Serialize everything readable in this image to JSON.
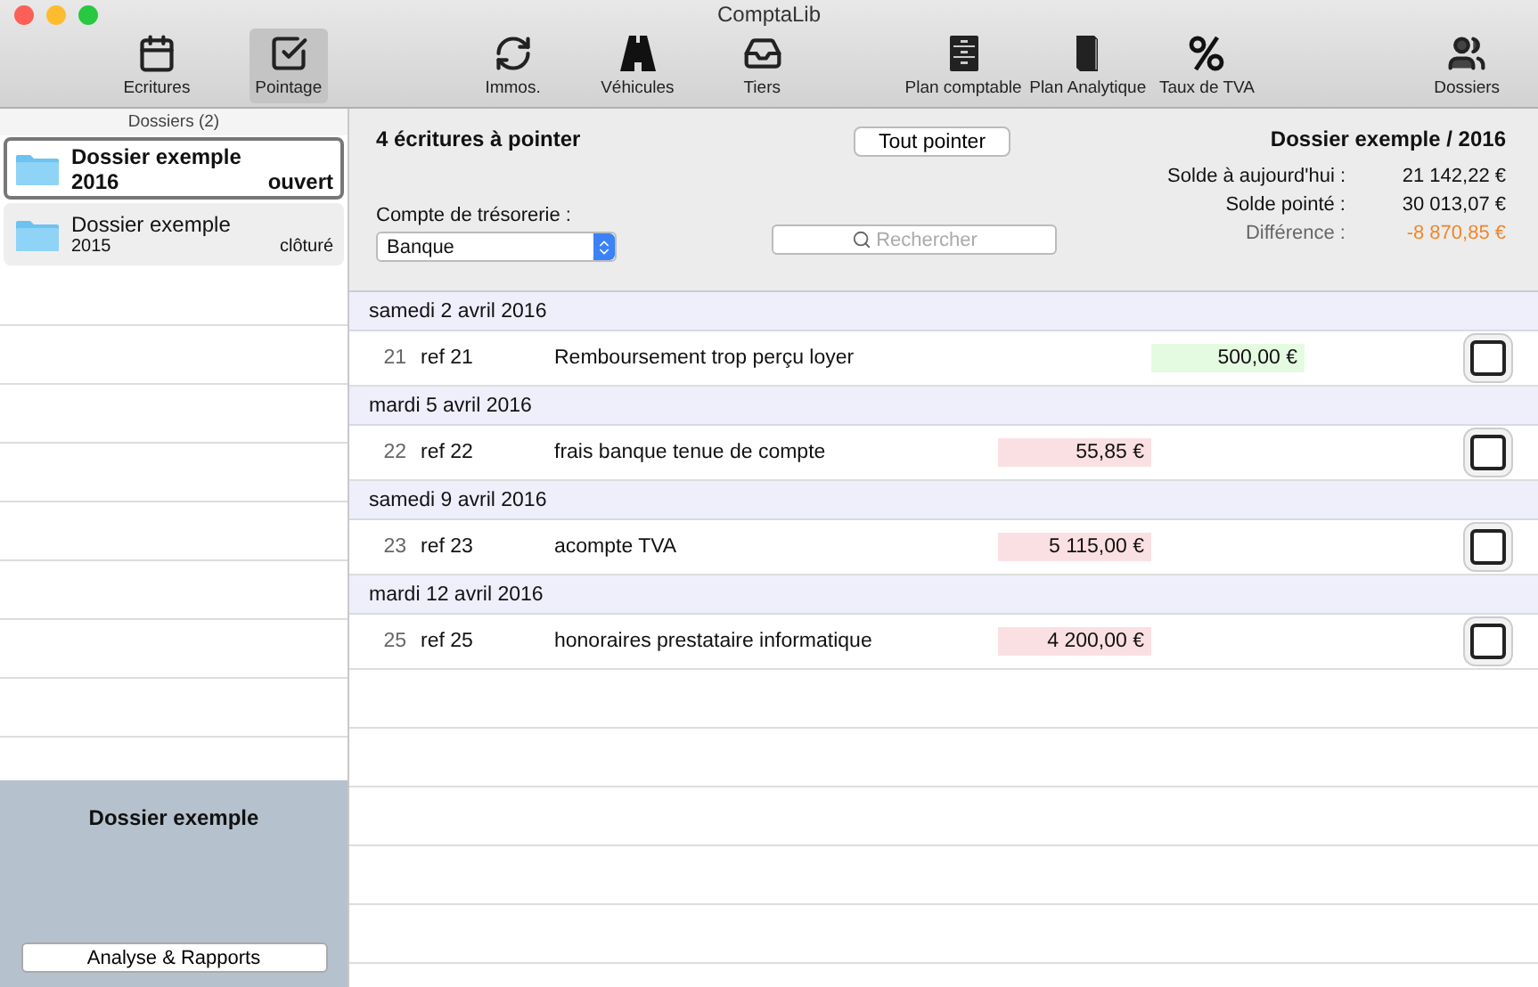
{
  "window": {
    "title": "ComptaLib"
  },
  "toolbar": [
    {
      "label": "Ecritures",
      "selected": false
    },
    {
      "label": "Pointage",
      "selected": true
    },
    {
      "label": "Immos.",
      "selected": false
    },
    {
      "label": "Véhicules",
      "selected": false
    },
    {
      "label": "Tiers",
      "selected": false
    },
    {
      "label": "Plan comptable",
      "selected": false
    },
    {
      "label": "Plan Analytique",
      "selected": false
    },
    {
      "label": "Taux de TVA",
      "selected": false
    },
    {
      "label": "Dossiers",
      "selected": false
    }
  ],
  "sidebar": {
    "header": "Dossiers (2)",
    "items": [
      {
        "name": "Dossier exemple",
        "year": "2016",
        "status": "ouvert",
        "selected": true
      },
      {
        "name": "Dossier exemple",
        "year": "2015",
        "status": "clôturé",
        "selected": false
      }
    ],
    "footer_title": "Dossier exemple",
    "footer_button": "Analyse & Rapports"
  },
  "summary": {
    "count": "4 écritures à pointer",
    "button": "Tout pointer",
    "dossier": "Dossier exemple / 2016",
    "account_label": "Compte de trésorerie :",
    "account_value": "Banque",
    "search_placeholder": "Rechercher",
    "balances": [
      {
        "label": "Solde à aujourd'hui :",
        "value": "21 142,22 €",
        "kind": "normal"
      },
      {
        "label": "Solde pointé :",
        "value": "30 013,07 €",
        "kind": "normal"
      },
      {
        "label": "Différence :",
        "value": "-8 870,85 €",
        "kind": "warning"
      }
    ]
  },
  "groups": [
    {
      "date": "samedi 2 avril 2016",
      "entries": [
        {
          "number": "21",
          "ref": "ref 21",
          "label": "Remboursement trop perçu loyer",
          "amount": "500,00 €",
          "kind": "credit",
          "checked": false
        }
      ]
    },
    {
      "date": "mardi 5 avril 2016",
      "entries": [
        {
          "number": "22",
          "ref": "ref 22",
          "label": "frais banque tenue de compte",
          "amount": "55,85 €",
          "kind": "debit",
          "checked": false
        }
      ]
    },
    {
      "date": "samedi 9 avril 2016",
      "entries": [
        {
          "number": "23",
          "ref": "ref 23",
          "label": "acompte TVA",
          "amount": "5 115,00 €",
          "kind": "debit",
          "checked": false
        }
      ]
    },
    {
      "date": "mardi 12 avril 2016",
      "entries": [
        {
          "number": "25",
          "ref": "ref 25",
          "label": "honoraires prestataire informatique",
          "amount": "4 200,00 €",
          "kind": "debit",
          "checked": false
        }
      ]
    }
  ]
}
